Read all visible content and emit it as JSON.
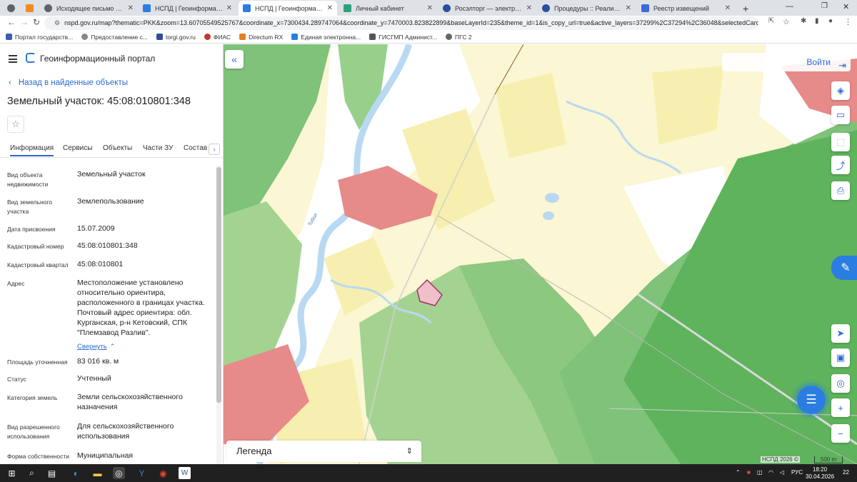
{
  "browser": {
    "tabs": [
      {
        "title": "",
        "color": "#5f6368"
      },
      {
        "title": "",
        "color": "#f08a24"
      },
      {
        "title": "Исходящее письмо для ФАС",
        "color": "#5f6368"
      },
      {
        "title": "НСПД | Геоинформационны...",
        "color": "#2a7de1"
      },
      {
        "title": "НСПД | Геоинформационны...",
        "color": "#2a7de1"
      },
      {
        "title": "Личный кабинет",
        "color": "#2ba37a"
      },
      {
        "title": "Росэлторг — электронная то",
        "color": "#2a4f9c"
      },
      {
        "title": "Процедуры :: Реализация гос",
        "color": "#2a4f9c"
      },
      {
        "title": "Реестр извещений",
        "color": "#3b6bd8"
      }
    ],
    "new_tab": "+",
    "url": "nspd.gov.ru/map?thematic=PKK&zoom=13.60705549525767&coordinate_x=7300434.289747064&coordinate_y=7470003.823822899&baseLayerId=235&theme_id=1&is_copy_url=true&active_layers=37299%2C37294%2C36048&selectedCard=112585...",
    "bookmarks": [
      {
        "label": "Портал государств...",
        "color": "#3c5bb4"
      },
      {
        "label": "Предоставление с...",
        "color": "#888888"
      },
      {
        "label": "torgi.gov.ru",
        "color": "#2a4f9c"
      },
      {
        "label": "ФИАС",
        "color": "#c0392b"
      },
      {
        "label": "Directum RX",
        "color": "#e67e22"
      },
      {
        "label": "Единая электронна...",
        "color": "#2a7de1"
      },
      {
        "label": "ГИСГМП Админист...",
        "color": "#555555"
      },
      {
        "label": "ПГС 2",
        "color": "#666666"
      }
    ]
  },
  "panel": {
    "portal_title": "Геоинформационный портал",
    "back_label": "Назад в найденные объекты",
    "object_title": "Земельный участок: 45:08:010801:348",
    "tabs": [
      "Информация",
      "Сервисы",
      "Объекты",
      "Части ЗУ",
      "Состав"
    ],
    "rows": [
      {
        "label": "Вид объекта недвижимости",
        "value": "Земельный участок"
      },
      {
        "label": "Вид земельного участка",
        "value": "Землепользование"
      },
      {
        "label": "Дата присвоения",
        "value": "15.07.2009"
      },
      {
        "label": "Кадастровый номер",
        "value": "45:08:010801:348"
      },
      {
        "label": "Кадастровый квартал",
        "value": "45:08:010801"
      },
      {
        "label": "Адрес",
        "value": "Местоположение установлено относительно ориентира, расположенного в границах участка. Почтовый адрес ориентира: обл. Курганская, р-н Кетовский, СПК \"Племзавод Разлив\"."
      },
      {
        "label": "Площадь уточненная",
        "value": "83 016 кв. м"
      },
      {
        "label": "Статус",
        "value": "Учтенный"
      },
      {
        "label": "Категория земель",
        "value": "Земли сельскохозяйственного назначения"
      },
      {
        "label": "Вид разрешенного использования",
        "value": "Для сельскохозяйственного использования"
      },
      {
        "label": "Форма собственности",
        "value": "Муниципальная"
      }
    ],
    "collapse_label": "Свернуть"
  },
  "map": {
    "login_label": "Войти",
    "legend_label": "Легенда",
    "attribution": "НСПД 2026 ©",
    "scale_label": "500 m",
    "river_label": "Тобол",
    "colors": {
      "forest": "#7fc27a",
      "forest_dark": "#5fb35c",
      "field": "#f7efaf",
      "settlement": "#e78a8a",
      "water": "#b9d9f2",
      "parcel_fill": "#f0c0c8",
      "parcel_stroke": "#a0306a",
      "accent": "#2a7de1"
    }
  },
  "taskbar": {
    "lang": "РУС",
    "time": "18:20",
    "date": "30.04.2026",
    "notif": "22"
  }
}
